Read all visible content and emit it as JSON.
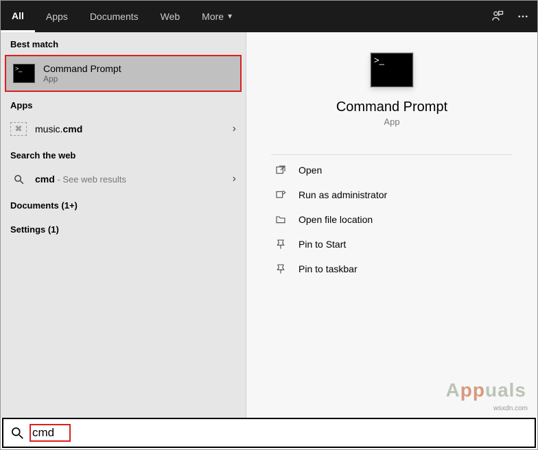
{
  "header": {
    "tabs": {
      "all": "All",
      "apps": "Apps",
      "documents": "Documents",
      "web": "Web",
      "more": "More"
    }
  },
  "left": {
    "best_match_label": "Best match",
    "best_match_title": "Command Prompt",
    "best_match_sub": "App",
    "apps_label": "Apps",
    "music_prefix": "music.",
    "music_bold": "cmd",
    "search_web_label": "Search the web",
    "web_bold": "cmd",
    "web_suffix": " - See web results",
    "documents_label": "Documents (1+)",
    "settings_label": "Settings (1)"
  },
  "right": {
    "title": "Command Prompt",
    "sub": "App",
    "actions": {
      "open": "Open",
      "run_admin": "Run as administrator",
      "open_location": "Open file location",
      "pin_start": "Pin to Start",
      "pin_taskbar": "Pin to taskbar"
    }
  },
  "search": {
    "query": "cmd"
  },
  "watermark": {
    "text_a": "A",
    "text_pp": "pp",
    "text_uals": "uals",
    "src": "wsxdn.com"
  }
}
